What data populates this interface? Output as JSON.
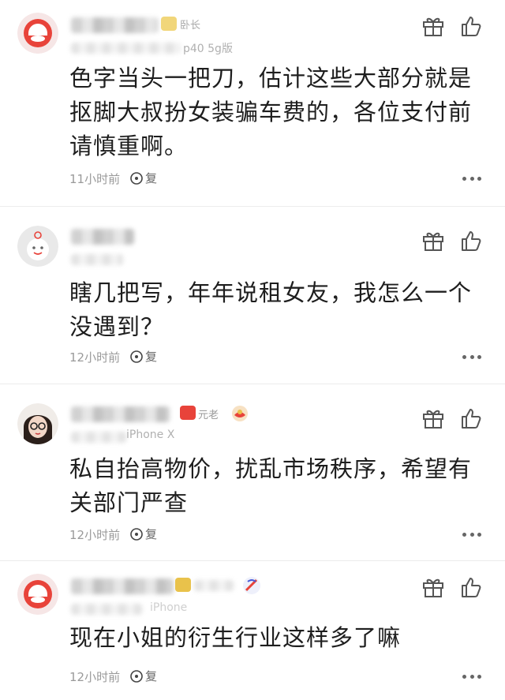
{
  "comments": [
    {
      "badge": "卧长",
      "device": "p40 5g版",
      "text": "色字当头一把刀，估计这些大部分就是抠脚大叔扮女装骗车费的，各位支付前请慎重啊。",
      "time": "11小时前",
      "reply_label": "复"
    },
    {
      "text": "瞎几把写，年年说租女友，我怎么一个没遇到？",
      "time": "12小时前",
      "reply_label": "复"
    },
    {
      "badge": "元老",
      "device": "iPhone X",
      "text": "私自抬高物价，扰乱市场秩序，希望有关部门严查",
      "time": "12小时前",
      "reply_label": "复"
    },
    {
      "device": "iPhone",
      "text": "现在小姐的衍生行业这样多了嘛",
      "time": "12小时前",
      "reply_label": "复"
    }
  ],
  "colors": {
    "text": "#1e1e1e",
    "meta": "#9a9a9a",
    "accent_red": "#e8433a",
    "badge_gold": "#e9c24b",
    "icon": "#555555",
    "divider": "#ececec"
  },
  "icons": [
    "gift-icon",
    "like-icon",
    "reply-icon",
    "more-icon"
  ]
}
